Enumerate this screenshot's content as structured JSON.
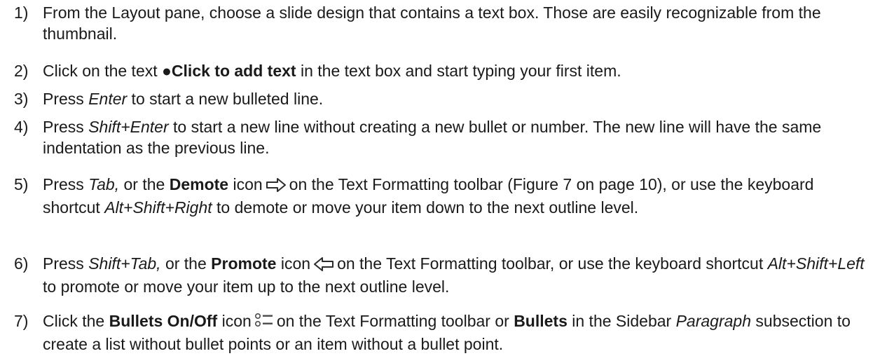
{
  "steps": [
    {
      "num": "1)",
      "parts": [
        {
          "t": "From the Layout pane, choose a slide design that contains a text box. Those are easily recognizable from the thumbnail."
        }
      ]
    },
    {
      "num": "2)",
      "parts": [
        {
          "t": "Click on the text "
        },
        {
          "t": "●Click to add text",
          "b": true
        },
        {
          "t": " in the text box and start typing your first item."
        }
      ]
    },
    {
      "num": "3)",
      "parts": [
        {
          "t": "Press "
        },
        {
          "t": "Enter",
          "i": true
        },
        {
          "t": " to start a new bulleted line."
        }
      ]
    },
    {
      "num": "4)",
      "parts": [
        {
          "t": "Press "
        },
        {
          "t": "Shift+Enter",
          "i": true
        },
        {
          "t": " to start a new line without creating a new bullet or number. The new line will have the same indentation as the previous line."
        }
      ]
    },
    {
      "num": "5)",
      "parts": [
        {
          "t": "Press "
        },
        {
          "t": "Tab,",
          "i": true
        },
        {
          "t": " or the "
        },
        {
          "t": "Demote",
          "b": true
        },
        {
          "t": " icon"
        },
        {
          "icon": "demote-arrow-icon"
        },
        {
          "t": "on the Text Formatting toolbar (Figure 7 on page 10), or use the keyboard shortcut "
        },
        {
          "t": "Alt+Shift+Right",
          "i": true
        },
        {
          "t": " to demote or move your item down to the next outline level."
        }
      ]
    },
    {
      "num": "6)",
      "parts": [
        {
          "t": "Press "
        },
        {
          "t": "Shift+Tab,",
          "i": true
        },
        {
          "t": " or the "
        },
        {
          "t": "Promote",
          "b": true
        },
        {
          "t": " icon"
        },
        {
          "icon": "promote-arrow-icon"
        },
        {
          "t": "on the Text Formatting toolbar, or use the keyboard shortcut "
        },
        {
          "t": "Alt+Shift+Left",
          "i": true
        },
        {
          "t": " to promote or move your item up to the next outline level."
        }
      ]
    },
    {
      "num": "7)",
      "parts": [
        {
          "t": "Click the "
        },
        {
          "t": "Bullets On/Off",
          "b": true
        },
        {
          "t": " icon"
        },
        {
          "icon": "bullets-list-icon"
        },
        {
          "t": "on the Text Formatting toolbar or "
        },
        {
          "t": "Bullets",
          "b": true
        },
        {
          "t": " in the Sidebar "
        },
        {
          "t": "Paragraph",
          "i": true
        },
        {
          "t": " subsection to create a list without bullet points or an item without a bullet point."
        }
      ]
    }
  ]
}
